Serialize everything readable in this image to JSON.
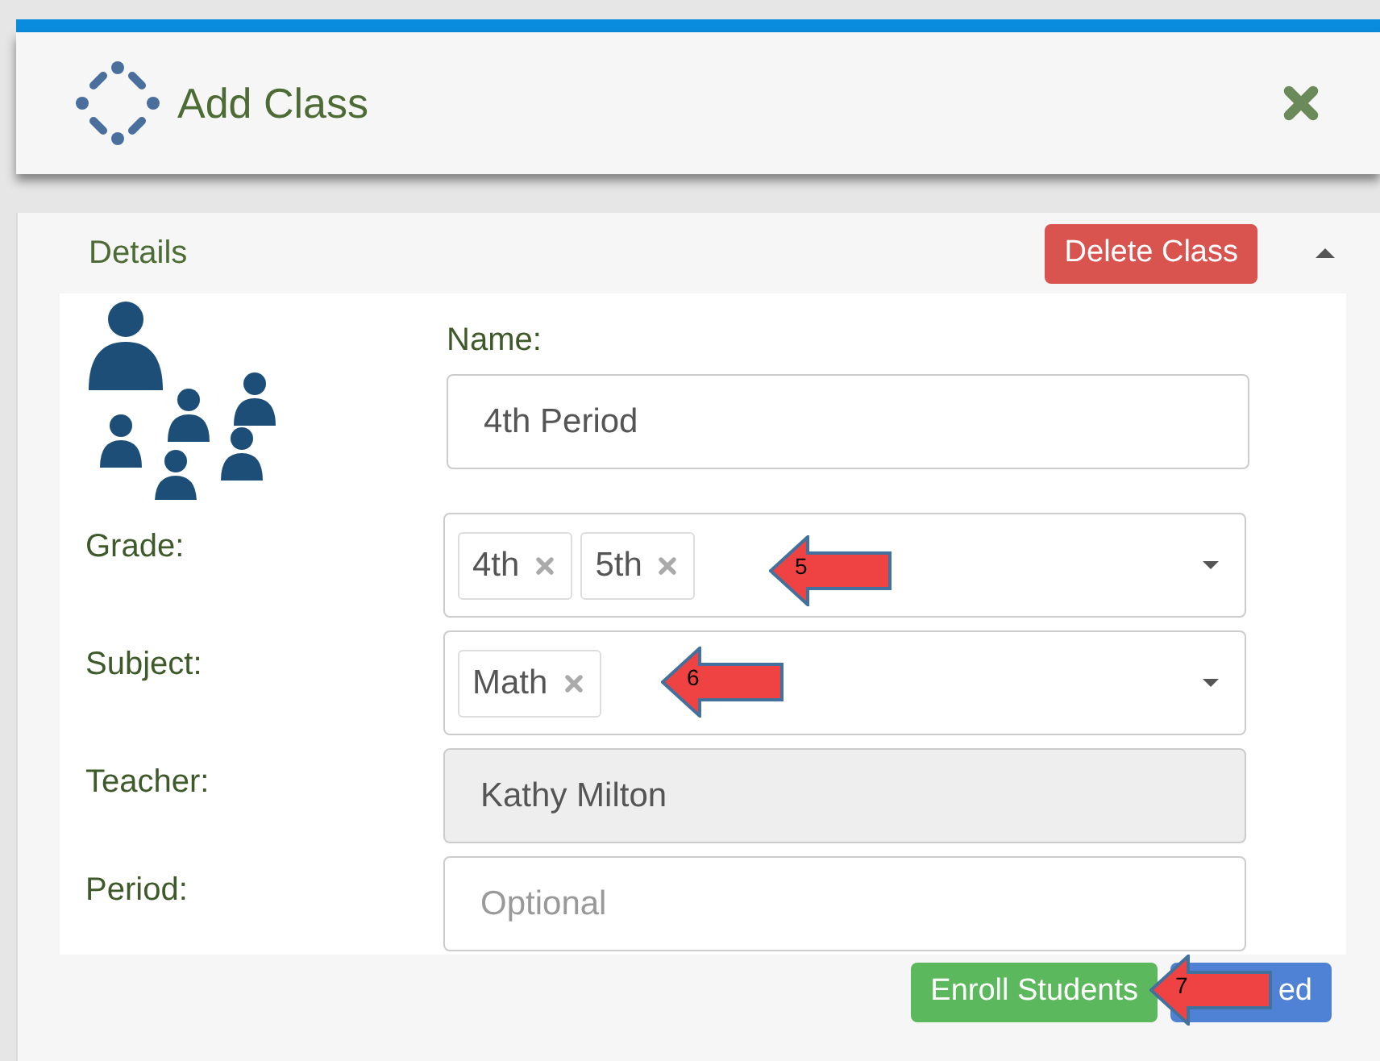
{
  "dialog": {
    "title": "Add Class"
  },
  "section": {
    "title": "Details",
    "expanded": true,
    "delete_button": "Delete Class"
  },
  "form": {
    "fields": [
      {
        "kind": "text",
        "label": "Name:",
        "value": "4th Period",
        "disabled": false
      },
      {
        "kind": "tags",
        "label": "Grade:",
        "tags": [
          "4th",
          "5th"
        ],
        "disabled": false
      },
      {
        "kind": "tags",
        "label": "Subject:",
        "tags": [
          "Math"
        ],
        "disabled": false
      },
      {
        "kind": "text",
        "label": "Teacher:",
        "value": "Kathy Milton",
        "disabled": true
      },
      {
        "kind": "text",
        "label": "Period:",
        "placeholder": "Optional",
        "disabled": false
      }
    ]
  },
  "buttons": [
    {
      "kind": "success",
      "label": "Enroll Students"
    },
    {
      "kind": "primary",
      "label": "ed"
    }
  ],
  "annotations": [
    {
      "label": "5"
    },
    {
      "label": "6"
    },
    {
      "label": "7"
    }
  ]
}
